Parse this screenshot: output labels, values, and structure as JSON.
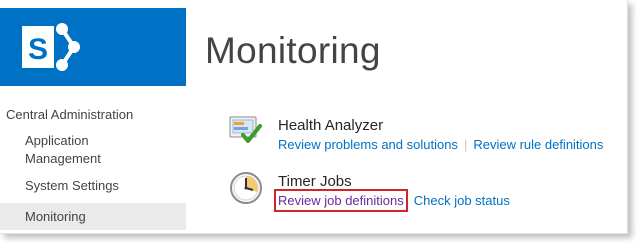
{
  "header": {
    "logo_letter": "S",
    "page_title": "Monitoring"
  },
  "nav": {
    "header": "Central Administration",
    "items": [
      {
        "label": "Application Management",
        "selected": false
      },
      {
        "label": "System Settings",
        "selected": false
      },
      {
        "label": "Monitoring",
        "selected": true
      }
    ]
  },
  "sections": {
    "health": {
      "icon": "health-analyzer-icon",
      "title": "Health Analyzer",
      "links": [
        "Review problems and solutions",
        "Review rule definitions"
      ]
    },
    "timer": {
      "icon": "timer-clock-icon",
      "title": "Timer Jobs",
      "links": [
        "Review job definitions",
        "Check job status"
      ]
    }
  },
  "colors": {
    "brand": "#0072c6",
    "link": "#0072c6",
    "visited_link": "#662b9c",
    "highlight_box": "#d0262b",
    "text": "#444444"
  }
}
